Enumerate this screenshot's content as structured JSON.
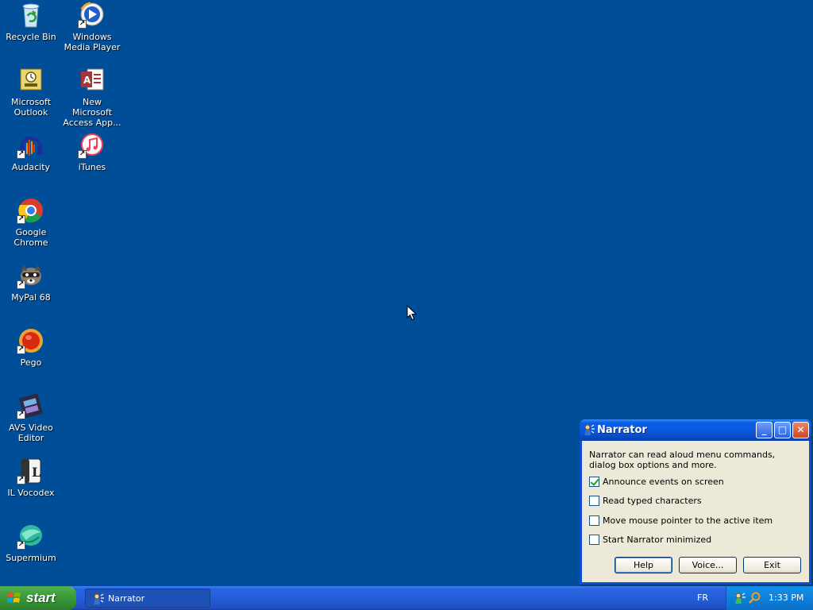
{
  "desktop": {
    "icons": [
      {
        "name": "Recycle Bin"
      },
      {
        "name": "Windows Media Player"
      },
      {
        "name": "Microsoft Outlook"
      },
      {
        "name": "New Microsoft Access App..."
      },
      {
        "name": "Audacity"
      },
      {
        "name": "iTunes"
      },
      {
        "name": "Google Chrome"
      },
      {
        "name": "MyPal 68"
      },
      {
        "name": "Pego"
      },
      {
        "name": "AVS Video Editor"
      },
      {
        "name": "IL Vocodex"
      },
      {
        "name": "Supermium"
      }
    ]
  },
  "narrator": {
    "title": "Narrator",
    "description": "Narrator can read aloud menu commands, dialog box options and more.",
    "options": [
      {
        "label": "Announce events on screen",
        "checked": true
      },
      {
        "label": "Read typed characters",
        "checked": false
      },
      {
        "label": "Move mouse pointer to the active item",
        "checked": false
      },
      {
        "label": "Start Narrator minimized",
        "checked": false
      }
    ],
    "buttons": {
      "help": "Help",
      "voice": "Voice...",
      "exit": "Exit"
    },
    "controls": {
      "minimize": "_",
      "maximize": "□",
      "close": "✕"
    }
  },
  "taskbar": {
    "start_label": "start",
    "tasks": [
      {
        "label": "Narrator"
      }
    ],
    "language": "FR",
    "clock": "1:33 PM"
  },
  "colors": {
    "desktop_bg": "#004e98",
    "taskbar_blue": "#245edb",
    "start_green": "#3c9c3c",
    "tray_blue": "#0f80d9"
  }
}
